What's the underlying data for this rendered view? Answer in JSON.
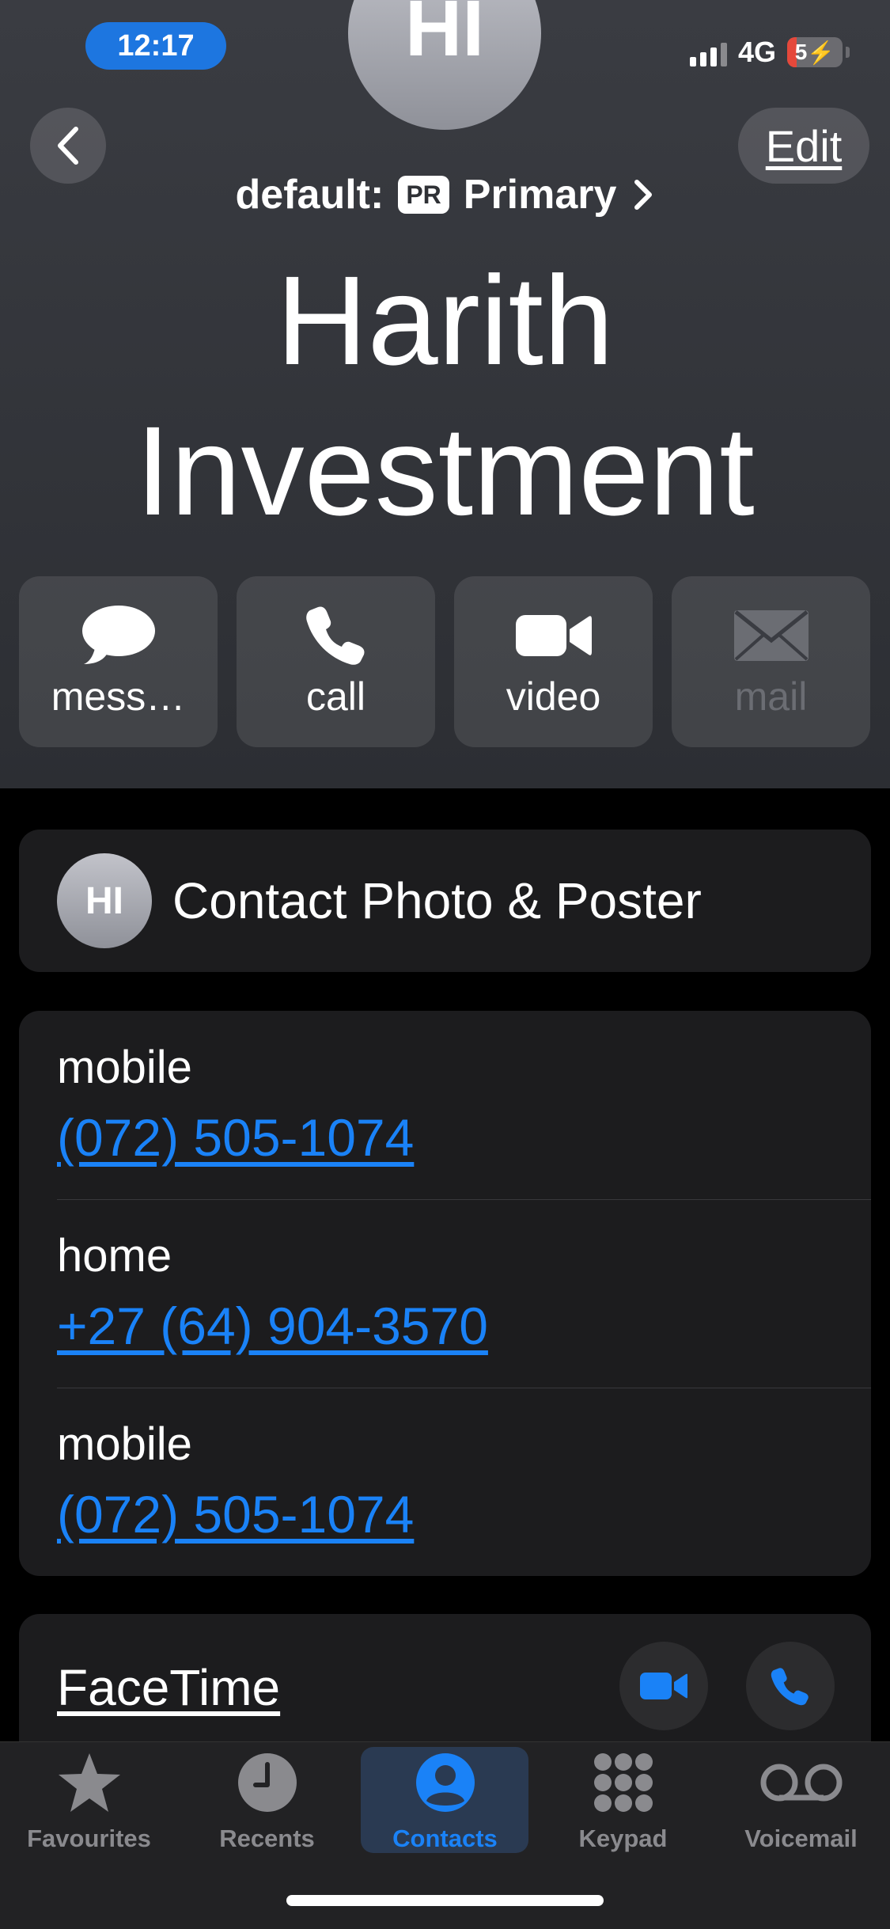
{
  "status_bar": {
    "time": "12:17",
    "network": "4G",
    "battery": "5"
  },
  "header": {
    "avatar_initials": "HI",
    "edit_label": "Edit",
    "default_prefix": "default:",
    "line_badge": "PR",
    "line_name": "Primary",
    "name_line1": "Harith",
    "name_line2": "Investment"
  },
  "actions": [
    {
      "label": "mess…",
      "icon": "message-bubble-icon",
      "enabled": true
    },
    {
      "label": "call",
      "icon": "phone-icon",
      "enabled": true
    },
    {
      "label": "video",
      "icon": "video-camera-icon",
      "enabled": true
    },
    {
      "label": "mail",
      "icon": "envelope-icon",
      "enabled": false
    }
  ],
  "poster": {
    "avatar_initials": "HI",
    "label": "Contact Photo & Poster"
  },
  "phones": [
    {
      "type": "mobile",
      "number": "(072) 505-1074"
    },
    {
      "type": "home",
      "number": "+27 (64) 904-3570"
    },
    {
      "type": "mobile",
      "number": "(072) 505-1074"
    }
  ],
  "facetime": {
    "label": "FaceTime"
  },
  "tabbar": {
    "active": "Contacts",
    "items": [
      {
        "label": "Favourites",
        "icon": "star-icon"
      },
      {
        "label": "Recents",
        "icon": "clock-icon"
      },
      {
        "label": "Contacts",
        "icon": "person-circle-icon"
      },
      {
        "label": "Keypad",
        "icon": "keypad-icon"
      },
      {
        "label": "Voicemail",
        "icon": "voicemail-icon"
      }
    ]
  },
  "colors": {
    "accent": "#1a82f7",
    "status_pill": "#1d76e0",
    "card": "#1c1c1e"
  }
}
